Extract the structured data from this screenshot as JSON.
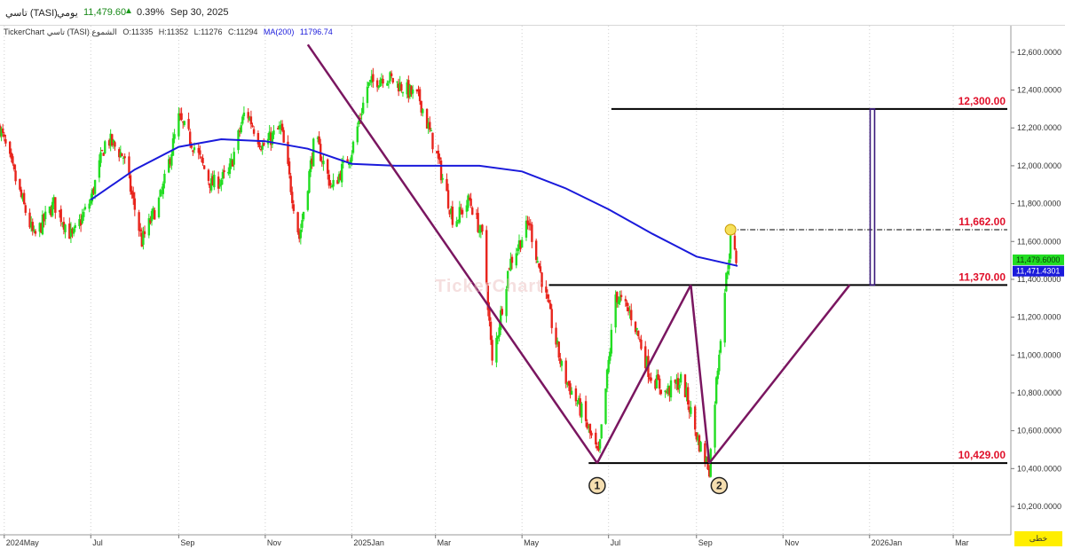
{
  "header": {
    "symbol": "تاسي (TASI)",
    "period": "يومي",
    "last_price": "11,479.60",
    "change_percent": "0.39%",
    "date": "Sep 30, 2025"
  },
  "info_bar": {
    "title": "TickerChart تاسي (TASI) الشموع",
    "open": "O:11335",
    "high": "H:11352",
    "low": "L:11276",
    "close": "C:11294",
    "ma_label": "MA(200)",
    "ma_value": "11796.74"
  },
  "watermark": "TickerChart",
  "corner_button": "خطى",
  "colors": {
    "up": "#22dd22",
    "down": "#e8241c",
    "ma": "#1a1adb",
    "pattern": "#7a1660",
    "levels": "#000000",
    "level_text": "#e0102a",
    "target_bar": "#3a1a7a",
    "last_price_tag": "#22dd22",
    "ma_tag": "#1a1adb"
  },
  "chart_data": {
    "type": "candlestick",
    "xlabel": "",
    "ylabel": "",
    "ylim": [
      10050,
      12740
    ],
    "y_ticks": [
      "12,600.0000",
      "12,400.0000",
      "12,200.0000",
      "12,000.0000",
      "11,800.0000",
      "11,600.0000",
      "11,400.0000",
      "11,200.0000",
      "11,000.0000",
      "10,800.0000",
      "10,600.0000",
      "10,400.0000",
      "10,200.0000"
    ],
    "x_ticks": [
      {
        "label": "2024May",
        "date": "2024-05-01"
      },
      {
        "label": "Jul",
        "date": "2024-07-01"
      },
      {
        "label": "Sep",
        "date": "2024-09-01"
      },
      {
        "label": "Nov",
        "date": "2024-11-01"
      },
      {
        "label": "2025Jan",
        "date": "2025-01-01"
      },
      {
        "label": "Mar",
        "date": "2025-03-01"
      },
      {
        "label": "May",
        "date": "2025-05-01"
      },
      {
        "label": "Jul",
        "date": "2025-07-01"
      },
      {
        "label": "Sep",
        "date": "2025-09-01"
      },
      {
        "label": "Nov",
        "date": "2025-11-01"
      },
      {
        "label": "2026Jan",
        "date": "2026-01-01"
      },
      {
        "label": "Mar",
        "date": "2026-03-01"
      }
    ],
    "date_range": [
      "2024-04-28",
      "2026-04-10"
    ],
    "price_path": [
      {
        "date": "2024-04-28",
        "close": 12200
      },
      {
        "date": "2024-05-10",
        "close": 11900
      },
      {
        "date": "2024-05-22",
        "close": 11620
      },
      {
        "date": "2024-06-05",
        "close": 11800
      },
      {
        "date": "2024-06-18",
        "close": 11620
      },
      {
        "date": "2024-07-01",
        "close": 11820
      },
      {
        "date": "2024-07-12",
        "close": 12150
      },
      {
        "date": "2024-07-24",
        "close": 12050
      },
      {
        "date": "2024-08-06",
        "close": 11600
      },
      {
        "date": "2024-08-20",
        "close": 11850
      },
      {
        "date": "2024-09-01",
        "close": 12250
      },
      {
        "date": "2024-09-12",
        "close": 12100
      },
      {
        "date": "2024-09-24",
        "close": 11900
      },
      {
        "date": "2024-10-06",
        "close": 11950
      },
      {
        "date": "2024-10-18",
        "close": 12300
      },
      {
        "date": "2024-10-30",
        "close": 12100
      },
      {
        "date": "2024-11-12",
        "close": 12200
      },
      {
        "date": "2024-11-25",
        "close": 11620
      },
      {
        "date": "2024-12-06",
        "close": 12150
      },
      {
        "date": "2024-12-18",
        "close": 11880
      },
      {
        "date": "2025-01-01",
        "close": 12080
      },
      {
        "date": "2025-01-12",
        "close": 12420
      },
      {
        "date": "2025-01-24",
        "close": 12480
      },
      {
        "date": "2025-02-05",
        "close": 12420
      },
      {
        "date": "2025-02-18",
        "close": 12350
      },
      {
        "date": "2025-03-02",
        "close": 12050
      },
      {
        "date": "2025-03-14",
        "close": 11700
      },
      {
        "date": "2025-03-25",
        "close": 11820
      },
      {
        "date": "2025-04-04",
        "close": 11600
      },
      {
        "date": "2025-04-10",
        "close": 10950
      },
      {
        "date": "2025-04-22",
        "close": 11480
      },
      {
        "date": "2025-05-06",
        "close": 11700
      },
      {
        "date": "2025-05-18",
        "close": 11300
      },
      {
        "date": "2025-05-30",
        "close": 10900
      },
      {
        "date": "2025-06-12",
        "close": 10700
      },
      {
        "date": "2025-06-24",
        "close": 10460
      },
      {
        "date": "2025-07-06",
        "close": 11320
      },
      {
        "date": "2025-07-18",
        "close": 11200
      },
      {
        "date": "2025-07-30",
        "close": 10900
      },
      {
        "date": "2025-08-10",
        "close": 10800
      },
      {
        "date": "2025-08-22",
        "close": 10870
      },
      {
        "date": "2025-09-02",
        "close": 10550
      },
      {
        "date": "2025-09-10",
        "close": 10400
      },
      {
        "date": "2025-09-15",
        "close": 10860
      },
      {
        "date": "2025-09-20",
        "close": 11280
      },
      {
        "date": "2025-09-25",
        "close": 11600
      },
      {
        "date": "2025-09-30",
        "close": 11480
      }
    ],
    "series": [
      {
        "name": "MA(200)",
        "type": "line",
        "points": [
          {
            "date": "2024-07-01",
            "value": 11820
          },
          {
            "date": "2024-08-01",
            "value": 11980
          },
          {
            "date": "2024-09-01",
            "value": 12100
          },
          {
            "date": "2024-10-01",
            "value": 12140
          },
          {
            "date": "2024-11-01",
            "value": 12130
          },
          {
            "date": "2024-12-01",
            "value": 12090
          },
          {
            "date": "2025-01-01",
            "value": 12010
          },
          {
            "date": "2025-02-01",
            "value": 12000
          },
          {
            "date": "2025-03-01",
            "value": 12000
          },
          {
            "date": "2025-04-01",
            "value": 12000
          },
          {
            "date": "2025-05-01",
            "value": 11970
          },
          {
            "date": "2025-06-01",
            "value": 11880
          },
          {
            "date": "2025-07-01",
            "value": 11770
          },
          {
            "date": "2025-08-01",
            "value": 11640
          },
          {
            "date": "2025-09-01",
            "value": 11520
          },
          {
            "date": "2025-09-30",
            "value": 11471
          }
        ]
      }
    ],
    "levels": [
      {
        "label": "12,300.00",
        "value": 12300,
        "from": "2025-07-03"
      },
      {
        "label": "11,662.00",
        "value": 11662,
        "from": "2025-09-25",
        "dashed": true
      },
      {
        "label": "11,370.00",
        "value": 11370,
        "from": "2025-05-20"
      },
      {
        "label": "10,429.00",
        "value": 10429,
        "from": "2025-06-17"
      }
    ],
    "pattern_lines": [
      [
        {
          "date": "2024-12-01",
          "value": 12640
        },
        {
          "date": "2025-06-23",
          "value": 10429
        }
      ],
      [
        {
          "date": "2025-06-23",
          "value": 10429
        },
        {
          "date": "2025-08-28",
          "value": 11370
        }
      ],
      [
        {
          "date": "2025-08-28",
          "value": 11370
        },
        {
          "date": "2025-09-10",
          "value": 10429
        }
      ],
      [
        {
          "date": "2025-09-10",
          "value": 10429
        },
        {
          "date": "2025-12-18",
          "value": 11370
        }
      ]
    ],
    "point_labels": [
      {
        "label": "1",
        "date": "2025-06-23",
        "value": 10310
      },
      {
        "label": "2",
        "date": "2025-09-17",
        "value": 10310
      }
    ],
    "target_projection": {
      "date": "2026-01-03",
      "from": 11370,
      "to": 12300
    },
    "marker": {
      "date": "2025-09-25",
      "value": 11662
    },
    "price_tags": [
      {
        "label": "11,479.6000",
        "value": 11479.6,
        "kind": "last"
      },
      {
        "label": "11,471.4301",
        "value": 11471.43,
        "kind": "ma"
      }
    ]
  }
}
